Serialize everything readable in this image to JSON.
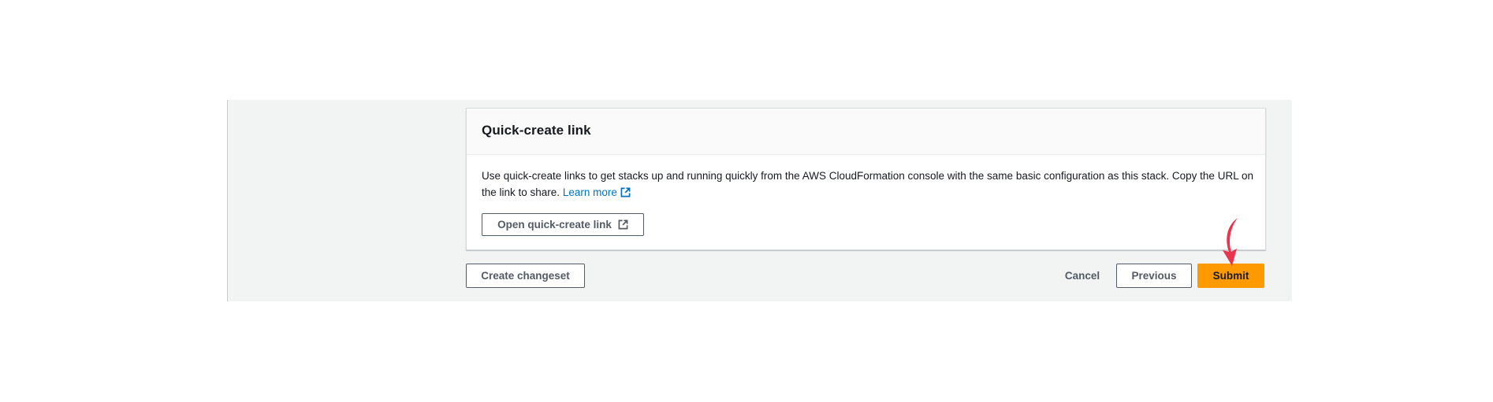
{
  "panel": {
    "title": "Quick-create link",
    "description_text": "Use quick-create links to get stacks up and running quickly from the AWS CloudFormation console with the same basic configuration as this stack. Copy the URL on the link to share.",
    "learn_more_label": "Learn more",
    "open_link_label": "Open quick-create link"
  },
  "footer": {
    "create_changeset_label": "Create changeset",
    "cancel_label": "Cancel",
    "previous_label": "Previous",
    "submit_label": "Submit"
  },
  "icons": {
    "external_link": "external-link-icon",
    "annotation_arrow": "arrow-down-icon"
  },
  "colors": {
    "primary_button": "#ff9900",
    "link": "#0073bb",
    "annotation_arrow": "#e8344e",
    "background": "#f2f3f3"
  }
}
